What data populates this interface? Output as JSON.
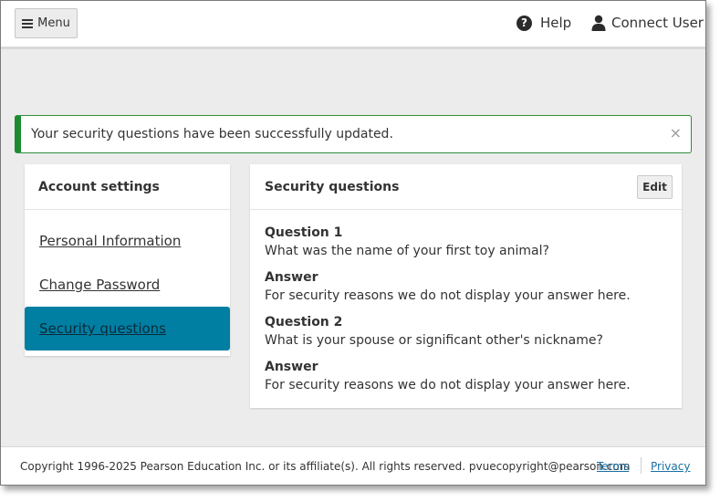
{
  "header": {
    "menu_label": "Menu",
    "help_label": "Help",
    "user_label": "Connect User"
  },
  "alert": {
    "message": "Your security questions have been successfully updated.",
    "close_symbol": "×",
    "accent_color": "#1e8b32"
  },
  "sidebar": {
    "title": "Account settings",
    "items": [
      {
        "label": "Personal Information",
        "active": false
      },
      {
        "label": "Change Password",
        "active": false
      },
      {
        "label": "Security questions",
        "active": true
      }
    ],
    "active_color": "#007fa3"
  },
  "main": {
    "title": "Security questions",
    "edit_label": "Edit",
    "entries": [
      {
        "label": "Question 1",
        "value": "What was the name of your first toy animal?"
      },
      {
        "label": "Answer",
        "value": "For security reasons we do not display your answer here."
      },
      {
        "label": "Question 2",
        "value": "What is your spouse or significant other's nickname?"
      },
      {
        "label": "Answer",
        "value": "For security reasons we do not display your answer here."
      }
    ]
  },
  "footer": {
    "copyright": "Copyright 1996-2025 Pearson Education Inc. or its affiliate(s). All rights reserved. pvuecopyright@pearson.com",
    "terms_label": "Terms",
    "privacy_label": "Privacy"
  }
}
